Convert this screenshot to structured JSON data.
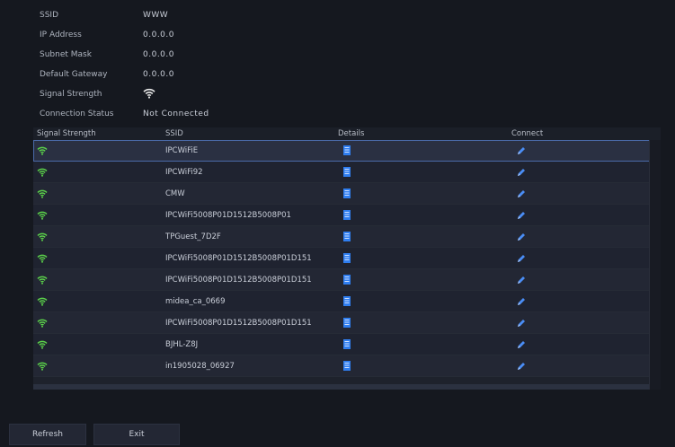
{
  "info": {
    "ssid_label": "SSID",
    "ssid_value": "WWW",
    "ip_label": "IP Address",
    "ip_value": "0.0.0.0",
    "mask_label": "Subnet Mask",
    "mask_value": "0.0.0.0",
    "gateway_label": "Default Gateway",
    "gateway_value": "0.0.0.0",
    "signal_label": "Signal Strength",
    "status_label": "Connection Status",
    "status_value": "Not Connected"
  },
  "table": {
    "headers": {
      "signal": "Signal Strength",
      "ssid": "SSID",
      "details": "Details",
      "connect": "Connect"
    },
    "rows": [
      {
        "ssid": "IPCWiFiE"
      },
      {
        "ssid": "IPCWiFi92"
      },
      {
        "ssid": "CMW"
      },
      {
        "ssid": "IPCWiFi5008P01D1512B5008P01"
      },
      {
        "ssid": "TPGuest_7D2F"
      },
      {
        "ssid": "IPCWiFi5008P01D1512B5008P01D151"
      },
      {
        "ssid": "IPCWiFi5008P01D1512B5008P01D151"
      },
      {
        "ssid": "midea_ca_0669"
      },
      {
        "ssid": "IPCWiFi5008P01D1512B5008P01D151"
      },
      {
        "ssid": "BJHL-Z8J"
      },
      {
        "ssid": "in1905028_06927"
      }
    ],
    "selected_index": 0
  },
  "footer": {
    "refresh_label": "Refresh",
    "exit_label": "Exit"
  },
  "icons": {
    "wifi": "wifi-signal-icon",
    "details": "details-icon",
    "connect": "pen-icon"
  },
  "colors": {
    "wifi_green": "#5bd14a",
    "details_blue": "#2f7ef0",
    "pen_blue": "#4a8df5"
  }
}
